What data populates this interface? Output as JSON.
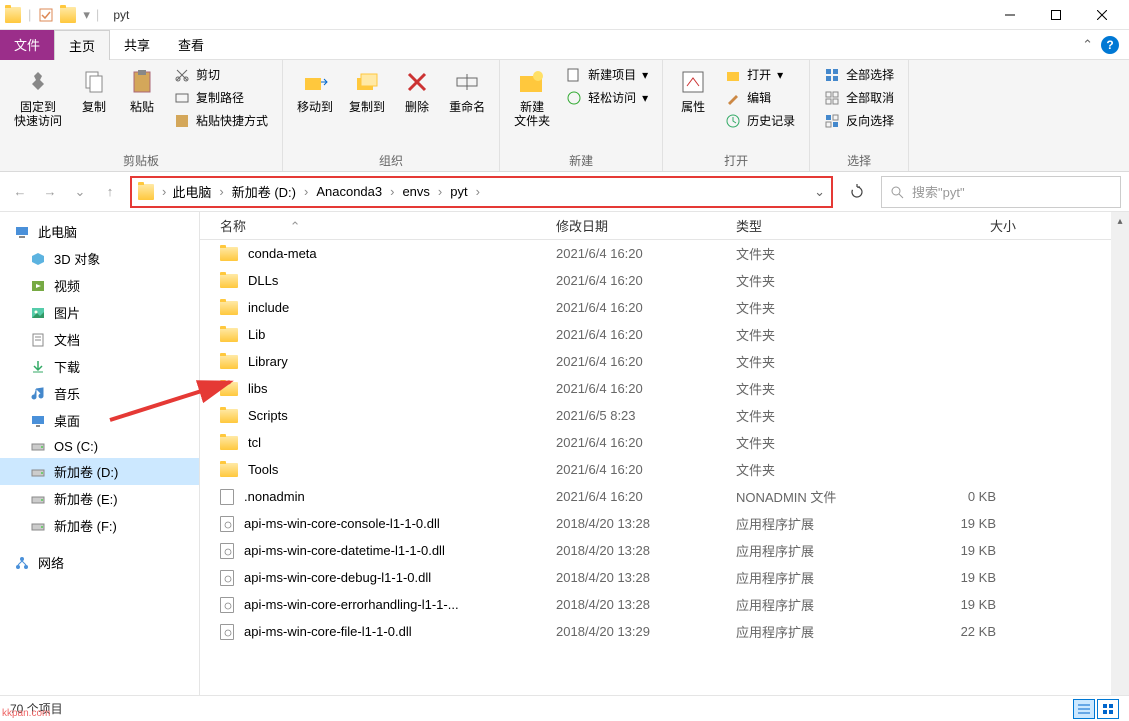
{
  "window": {
    "title": "pyt"
  },
  "tabs": {
    "file": "文件",
    "home": "主页",
    "share": "共享",
    "view": "查看"
  },
  "ribbon": {
    "group_clipboard": "剪贴板",
    "group_organize": "组织",
    "group_new": "新建",
    "group_open": "打开",
    "group_select": "选择",
    "pin": "固定到\n快速访问",
    "copy": "复制",
    "paste": "粘贴",
    "cut": "剪切",
    "copy_path": "复制路径",
    "paste_shortcut": "粘贴快捷方式",
    "move_to": "移动到",
    "copy_to": "复制到",
    "delete": "删除",
    "rename": "重命名",
    "new_folder": "新建\n文件夹",
    "new_item": "新建项目",
    "easy_access": "轻松访问",
    "properties": "属性",
    "open": "打开",
    "edit": "编辑",
    "history": "历史记录",
    "select_all": "全部选择",
    "select_none": "全部取消",
    "invert_sel": "反向选择"
  },
  "breadcrumb": [
    "此电脑",
    "新加卷 (D:)",
    "Anaconda3",
    "envs",
    "pyt"
  ],
  "search_placeholder": "搜索\"pyt\"",
  "sidebar": {
    "this_pc": "此电脑",
    "items": [
      {
        "label": "3D 对象",
        "icon": "cube"
      },
      {
        "label": "视频",
        "icon": "video"
      },
      {
        "label": "图片",
        "icon": "picture"
      },
      {
        "label": "文档",
        "icon": "doc"
      },
      {
        "label": "下载",
        "icon": "download"
      },
      {
        "label": "音乐",
        "icon": "music"
      },
      {
        "label": "桌面",
        "icon": "desktop"
      },
      {
        "label": "OS (C:)",
        "icon": "drive"
      },
      {
        "label": "新加卷 (D:)",
        "icon": "drive",
        "selected": true
      },
      {
        "label": "新加卷 (E:)",
        "icon": "drive"
      },
      {
        "label": "新加卷 (F:)",
        "icon": "drive"
      }
    ],
    "network": "网络"
  },
  "columns": {
    "name": "名称",
    "date": "修改日期",
    "type": "类型",
    "size": "大小"
  },
  "files": [
    {
      "name": "conda-meta",
      "date": "2021/6/4 16:20",
      "type": "文件夹",
      "size": "",
      "kind": "folder"
    },
    {
      "name": "DLLs",
      "date": "2021/6/4 16:20",
      "type": "文件夹",
      "size": "",
      "kind": "folder"
    },
    {
      "name": "include",
      "date": "2021/6/4 16:20",
      "type": "文件夹",
      "size": "",
      "kind": "folder"
    },
    {
      "name": "Lib",
      "date": "2021/6/4 16:20",
      "type": "文件夹",
      "size": "",
      "kind": "folder"
    },
    {
      "name": "Library",
      "date": "2021/6/4 16:20",
      "type": "文件夹",
      "size": "",
      "kind": "folder"
    },
    {
      "name": "libs",
      "date": "2021/6/4 16:20",
      "type": "文件夹",
      "size": "",
      "kind": "folder"
    },
    {
      "name": "Scripts",
      "date": "2021/6/5 8:23",
      "type": "文件夹",
      "size": "",
      "kind": "folder"
    },
    {
      "name": "tcl",
      "date": "2021/6/4 16:20",
      "type": "文件夹",
      "size": "",
      "kind": "folder"
    },
    {
      "name": "Tools",
      "date": "2021/6/4 16:20",
      "type": "文件夹",
      "size": "",
      "kind": "folder"
    },
    {
      "name": ".nonadmin",
      "date": "2021/6/4 16:20",
      "type": "NONADMIN 文件",
      "size": "0 KB",
      "kind": "file"
    },
    {
      "name": "api-ms-win-core-console-l1-1-0.dll",
      "date": "2018/4/20 13:28",
      "type": "应用程序扩展",
      "size": "19 KB",
      "kind": "dll"
    },
    {
      "name": "api-ms-win-core-datetime-l1-1-0.dll",
      "date": "2018/4/20 13:28",
      "type": "应用程序扩展",
      "size": "19 KB",
      "kind": "dll"
    },
    {
      "name": "api-ms-win-core-debug-l1-1-0.dll",
      "date": "2018/4/20 13:28",
      "type": "应用程序扩展",
      "size": "19 KB",
      "kind": "dll"
    },
    {
      "name": "api-ms-win-core-errorhandling-l1-1-...",
      "date": "2018/4/20 13:28",
      "type": "应用程序扩展",
      "size": "19 KB",
      "kind": "dll"
    },
    {
      "name": "api-ms-win-core-file-l1-1-0.dll",
      "date": "2018/4/20 13:29",
      "type": "应用程序扩展",
      "size": "22 KB",
      "kind": "dll"
    }
  ],
  "status": {
    "items": "70 个项目"
  },
  "watermark": "kkpan.com"
}
